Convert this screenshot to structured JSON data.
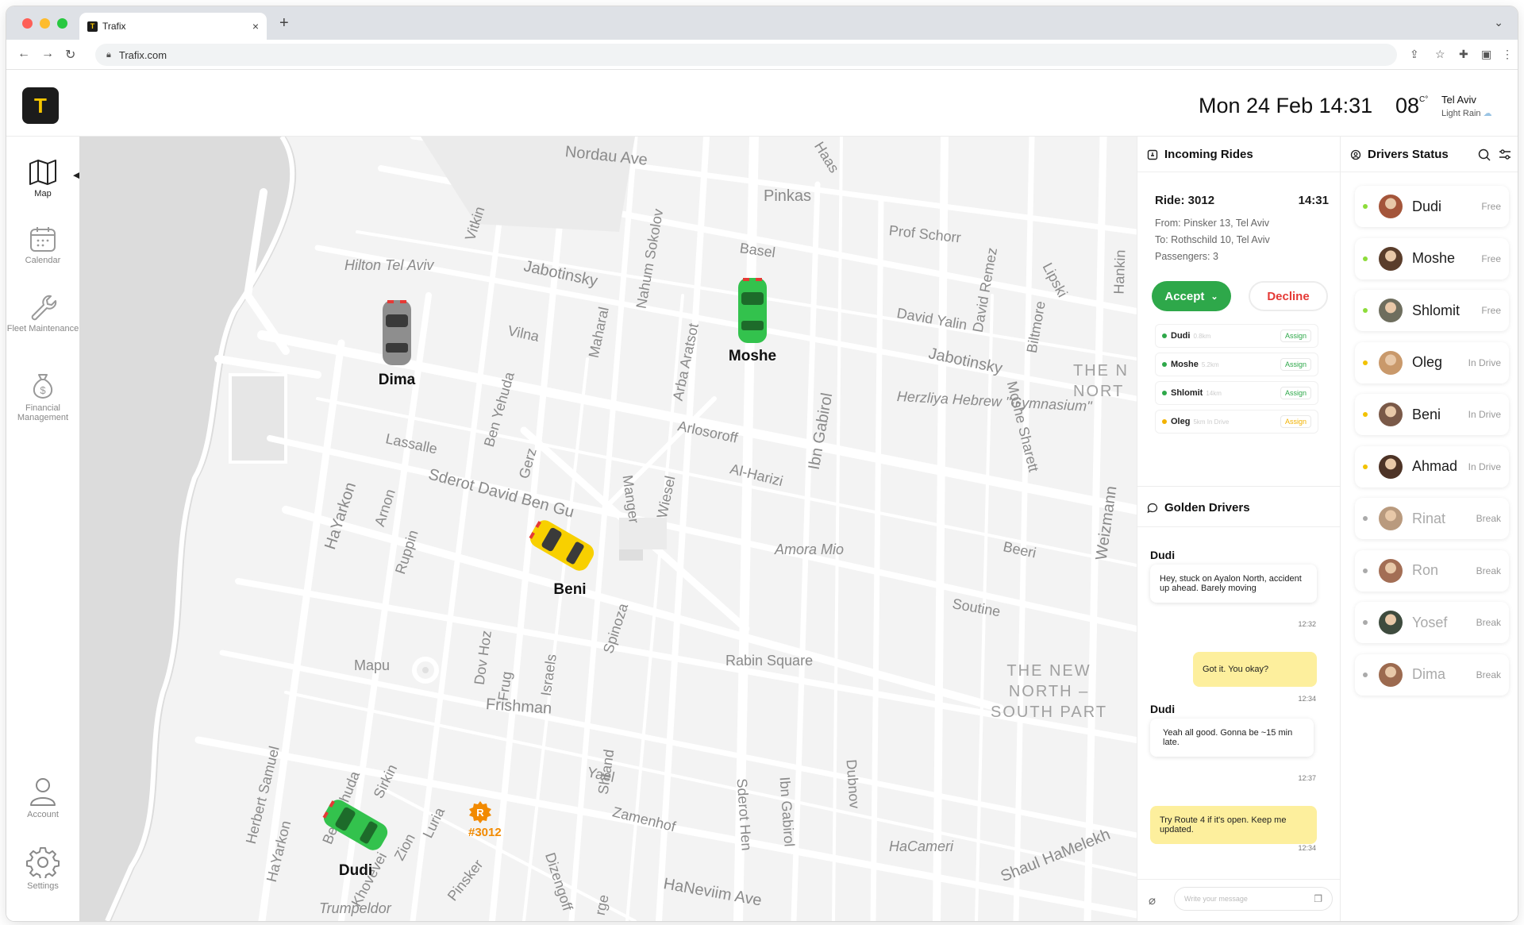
{
  "browser": {
    "tab_title": "Trafix",
    "tab_favicon": "T",
    "url": "Trafix.com",
    "new_tab": "+",
    "tab_close": "×"
  },
  "header": {
    "logo": "T",
    "date": "Mon 24 Feb 14:31",
    "temperature": "08",
    "temperature_unit": "C°",
    "city": "Tel Aviv",
    "condition": "Light Rain"
  },
  "nav": {
    "items": [
      {
        "label": "Map",
        "icon": "map-icon",
        "active": true
      },
      {
        "label": "Calendar",
        "icon": "calendar-icon"
      },
      {
        "label": "Fleet Maintenance",
        "icon": "wrench-icon"
      },
      {
        "label": "Financial Management",
        "icon": "money-bag-icon"
      },
      {
        "label": "Account",
        "icon": "user-icon"
      },
      {
        "label": "Settings",
        "icon": "gear-icon"
      }
    ]
  },
  "map": {
    "streets": [
      "Nordau Ave",
      "Haas",
      "Pinkas",
      "Hilton Tel Aviv",
      "Vitkin",
      "Jabotinsky",
      "Nahum Sokolov",
      "Basel",
      "Prof Schorr",
      "David Remez",
      "Lipski",
      "Hankin",
      "Vilna",
      "Maharal",
      "Arba Aratsot",
      "David Yalin",
      "Biltmore",
      "Jabotinsky",
      "Lassalle",
      "Ben Yehuda",
      "Gerz",
      "Manger",
      "Arlosoroff",
      "Ibn Gabirol",
      "Herzliya Hebrew \"Gymnasium\"",
      "Moshe Sharett",
      "Sderot David Ben Gu",
      "Al-Harizi",
      "Wiesel",
      "HaYarkon",
      "Arnon",
      "Ruppin",
      "Amora Mio",
      "Beeri",
      "Weizmann",
      "Soutine",
      "Spinoza",
      "Dov Hoz",
      "Mapu",
      "Frug",
      "Israels",
      "Rabin Square",
      "Frishman",
      "Herbert Samuel",
      "HaYarkon",
      "Ben Yehuda",
      "Sirkin",
      "Zion",
      "Luria",
      "Yael",
      "Shtand",
      "Sderot Hen",
      "Ibn Gabirol",
      "Dubnov",
      "Zamenhof",
      "Khovevei",
      "Pinsker",
      "Dizengoff",
      "HaCameri",
      "Shaul HaMelekh",
      "HaNeviim Ave",
      "Trumpeldor",
      "rge"
    ],
    "districts": [
      "THE N\nNORT",
      "THE NEW\nNORTH –\nSOUTH PART"
    ],
    "cars": [
      {
        "driver": "Dima",
        "color": "#8e8e8e"
      },
      {
        "driver": "Moshe",
        "color": "#33c24d"
      },
      {
        "driver": "Beni",
        "color": "#f8d000"
      },
      {
        "driver": "Dudi",
        "color": "#33c24d"
      }
    ],
    "ride_pin": {
      "letter": "R",
      "label": "#3012",
      "color": "#f28a00"
    }
  },
  "incoming_rides": {
    "title": "Incoming Rides",
    "ride": {
      "id": "Ride: 3012",
      "time": "14:31",
      "from": "From: Pinsker 13, Tel Aviv",
      "to": "To: Rothschild 10, Tel Aviv",
      "passengers": "Passengers: 3"
    },
    "accept_label": "Accept",
    "decline_label": "Decline",
    "candidates": [
      {
        "name": "Dudi",
        "distance": "0.8km",
        "action": "Assign",
        "color": "#2ea84a"
      },
      {
        "name": "Moshe",
        "distance": "5.2km",
        "action": "Assign",
        "color": "#2ea84a"
      },
      {
        "name": "Shlomit",
        "distance": "14km",
        "action": "Assign",
        "color": "#2ea84a"
      },
      {
        "name": "Oleg",
        "distance": "5km In Drive",
        "action": "Assign",
        "color": "#f2b200"
      }
    ]
  },
  "golden_drivers": {
    "title": "Golden Drivers",
    "messages": [
      {
        "sender": "Dudi",
        "text": "Hey, stuck on Ayalon North, accident up ahead. Barely moving",
        "time": "12:32"
      },
      {
        "text": "Got it. You okay?",
        "time": "12:34"
      },
      {
        "sender": "Dudi",
        "text": "Yeah all good. Gonna be ~15 min late.",
        "time": "12:37"
      },
      {
        "text": "Try Route 4 if it's open. Keep me updated.",
        "time": "12:34"
      }
    ],
    "input_placeholder": "Write your message"
  },
  "drivers_status": {
    "title": "Drivers Status",
    "drivers": [
      {
        "name": "Dudi",
        "status": "Free",
        "dot": "#8ddc3a",
        "avatar": "#a4553a"
      },
      {
        "name": "Moshe",
        "status": "Free",
        "dot": "#8ddc3a",
        "avatar": "#5a3d2b"
      },
      {
        "name": "Shlomit",
        "status": "Free",
        "dot": "#8ddc3a",
        "avatar": "#6e6e5e"
      },
      {
        "name": "Oleg",
        "status": "In Drive",
        "dot": "#f2c200",
        "avatar": "#c9996b"
      },
      {
        "name": "Beni",
        "status": "In Drive",
        "dot": "#f2c200",
        "avatar": "#7a5948"
      },
      {
        "name": "Ahmad",
        "status": "In Drive",
        "dot": "#f2c200",
        "avatar": "#4d3326"
      },
      {
        "name": "Rinat",
        "status": "Break",
        "dot": "#aaaaaa",
        "avatar": "#b99a7e"
      },
      {
        "name": "Ron",
        "status": "Break",
        "dot": "#aaaaaa",
        "avatar": "#a36e55"
      },
      {
        "name": "Yosef",
        "status": "Break",
        "dot": "#aaaaaa",
        "avatar": "#3e4b3e"
      },
      {
        "name": "Dima",
        "status": "Break",
        "dot": "#aaaaaa",
        "avatar": "#9c6a4f"
      }
    ]
  }
}
